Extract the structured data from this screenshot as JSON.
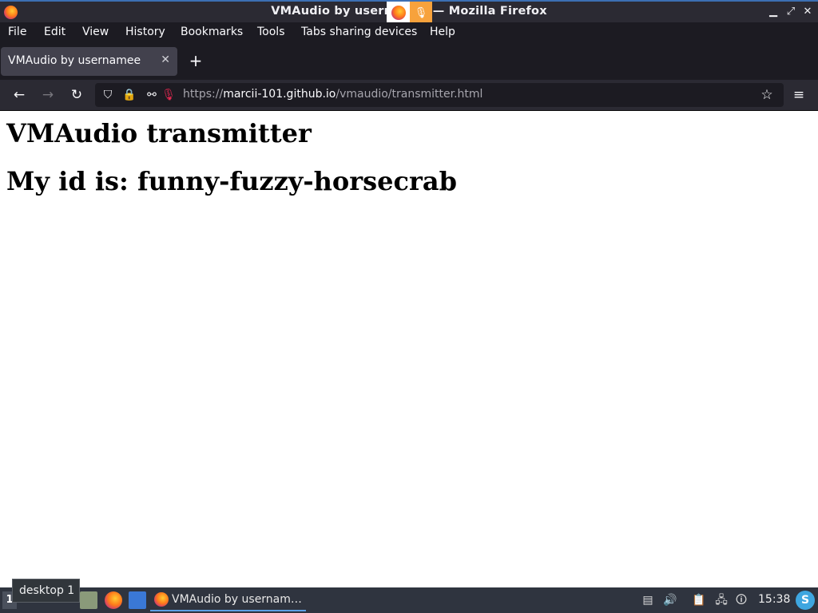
{
  "window": {
    "title": "VMAudio by usernamee — Mozilla Firefox"
  },
  "menu": [
    "File",
    "Edit",
    "View",
    "History",
    "Bookmarks",
    "Tools",
    "Tabs sharing devices",
    "Help"
  ],
  "tabs": [
    {
      "label": "VMAudio by usernamee",
      "active": true
    }
  ],
  "address_bar": {
    "prefix": "https://",
    "host": "marcii-101.github.io",
    "path": "/vmaudio/transmitter.html"
  },
  "page": {
    "heading": "VMAudio transmitter",
    "id_line": "My id is: funny-fuzzy-horsecrab"
  },
  "tooltip": "desktop 1",
  "taskbar": {
    "desktop_number": "1",
    "task_label": "VMAudio by usernam…",
    "clock": "15:38",
    "accent": "#5aa0e6"
  },
  "icons": {
    "firefox": "firefox-icon",
    "microphone": "microphone-icon",
    "shield": "shield-icon",
    "lock": "lock-icon",
    "star": "star-icon",
    "hamburger": "menu-icon"
  }
}
